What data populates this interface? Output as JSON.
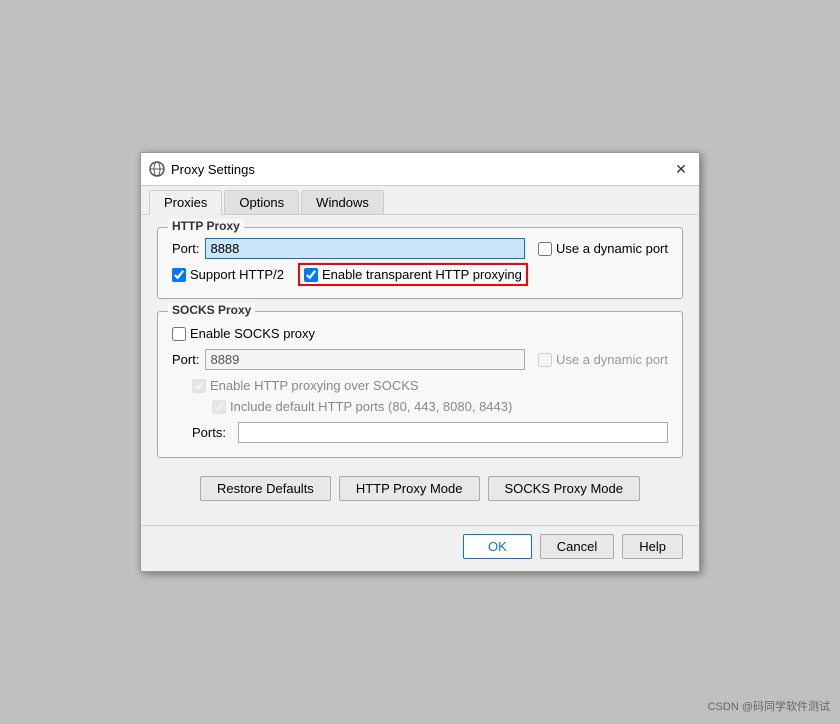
{
  "window": {
    "title": "Proxy Settings",
    "icon": "proxy-icon",
    "close_label": "✕"
  },
  "tabs": [
    {
      "id": "proxies",
      "label": "Proxies",
      "active": true
    },
    {
      "id": "options",
      "label": "Options",
      "active": false
    },
    {
      "id": "windows",
      "label": "Windows",
      "active": false
    }
  ],
  "http_proxy_section": {
    "title": "HTTP Proxy",
    "port_label": "Port:",
    "port_value": "8888",
    "dynamic_port_label": "Use a dynamic port",
    "support_http2_label": "Support HTTP/2",
    "support_http2_checked": true,
    "transparent_label": "Enable transparent HTTP proxying",
    "transparent_checked": true
  },
  "socks_proxy_section": {
    "title": "SOCKS Proxy",
    "enable_label": "Enable SOCKS proxy",
    "enable_checked": false,
    "port_label": "Port:",
    "port_value": "8889",
    "dynamic_port_label": "Use a dynamic port",
    "http_over_socks_label": "Enable HTTP proxying over SOCKS",
    "http_over_socks_checked": true,
    "include_ports_label": "Include default HTTP ports (80, 443, 8080, 8443)",
    "include_ports_checked": true,
    "ports_label": "Ports:"
  },
  "buttons": {
    "restore_defaults": "Restore Defaults",
    "http_proxy_mode": "HTTP Proxy Mode",
    "socks_proxy_mode": "SOCKS Proxy Mode"
  },
  "footer": {
    "ok": "OK",
    "cancel": "Cancel",
    "help": "Help"
  },
  "watermark": "CSDN @码同学软件测试"
}
